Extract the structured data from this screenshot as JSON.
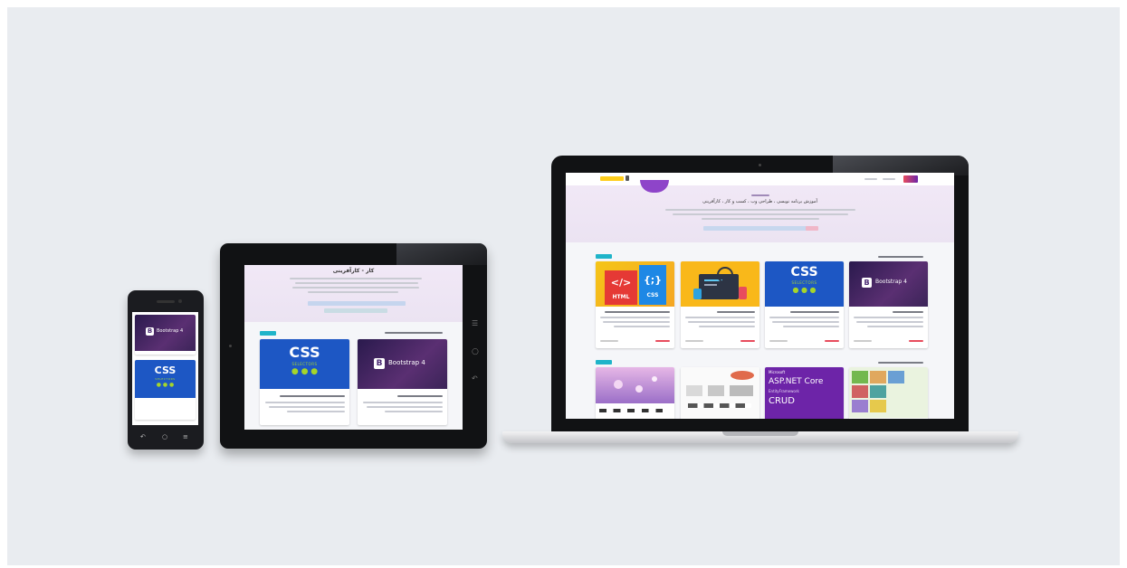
{
  "colors": {
    "background": "#e9ecf0",
    "hero": "#ede4f4",
    "accent_purple": "#6d24a8",
    "badge_cyan": "#1fb4c9",
    "css_blue": "#1d57c4",
    "css_green": "#a5d52b",
    "html_yellow": "#f5c518"
  },
  "thumbs": {
    "bootstrap": {
      "letter": "B",
      "text": "Bootstrap 4"
    },
    "css": {
      "title": "CSS",
      "subtitle": "SELECTORS",
      "dots": "● ● ●"
    },
    "html": {
      "left": "</>",
      "left_label": "HTML",
      "right": "{;}",
      "right_label": "CSS"
    },
    "asp": {
      "brand": "Microsoft",
      "title": "ASP.NET Core",
      "sub": "EntityFramework",
      "bottom": "CRUD"
    }
  },
  "tablet": {
    "hero_title": "کار - کارآفرینی"
  },
  "laptop": {
    "hero_title": "آموزش برنامه نویسی ، طراحی وب ، کسب و کار ، کارآفرینی"
  },
  "icons": {
    "phone_back": "back-icon",
    "phone_home": "home-icon",
    "phone_menu": "menu-icon",
    "tablet_home": "home-icon",
    "tablet_power": "power-icon"
  }
}
